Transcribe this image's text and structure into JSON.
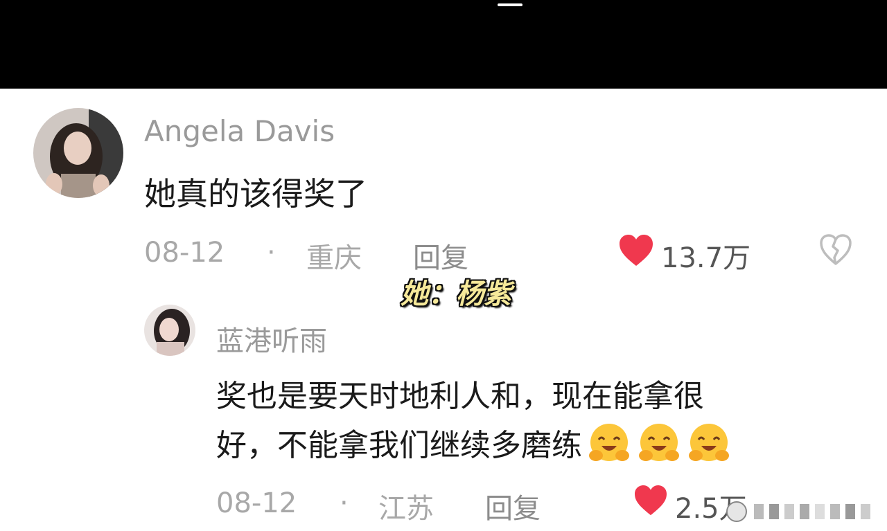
{
  "comments": [
    {
      "username": "Angela  Davis",
      "text": "她真的该得奖了",
      "date": "08-12",
      "dot": "·",
      "location": "重庆",
      "reply_label": "回复",
      "likes": "13.7万"
    }
  ],
  "replies": [
    {
      "username": "蓝港听雨",
      "text_line1": "奖也是要天时地利人和，现在能拿很",
      "text_line2": "好，不能拿我们继续多磨练",
      "emoji_name": "grinning-hug-emoji",
      "date": "08-12",
      "dot": "·",
      "location": "江苏",
      "reply_label": "回复",
      "likes": "2.5万"
    }
  ],
  "overlay": {
    "caption": "她：杨紫"
  },
  "colors": {
    "like_red": "#f0384e",
    "top_bar": "#000000",
    "meta_gray": "#a8a8a8"
  }
}
